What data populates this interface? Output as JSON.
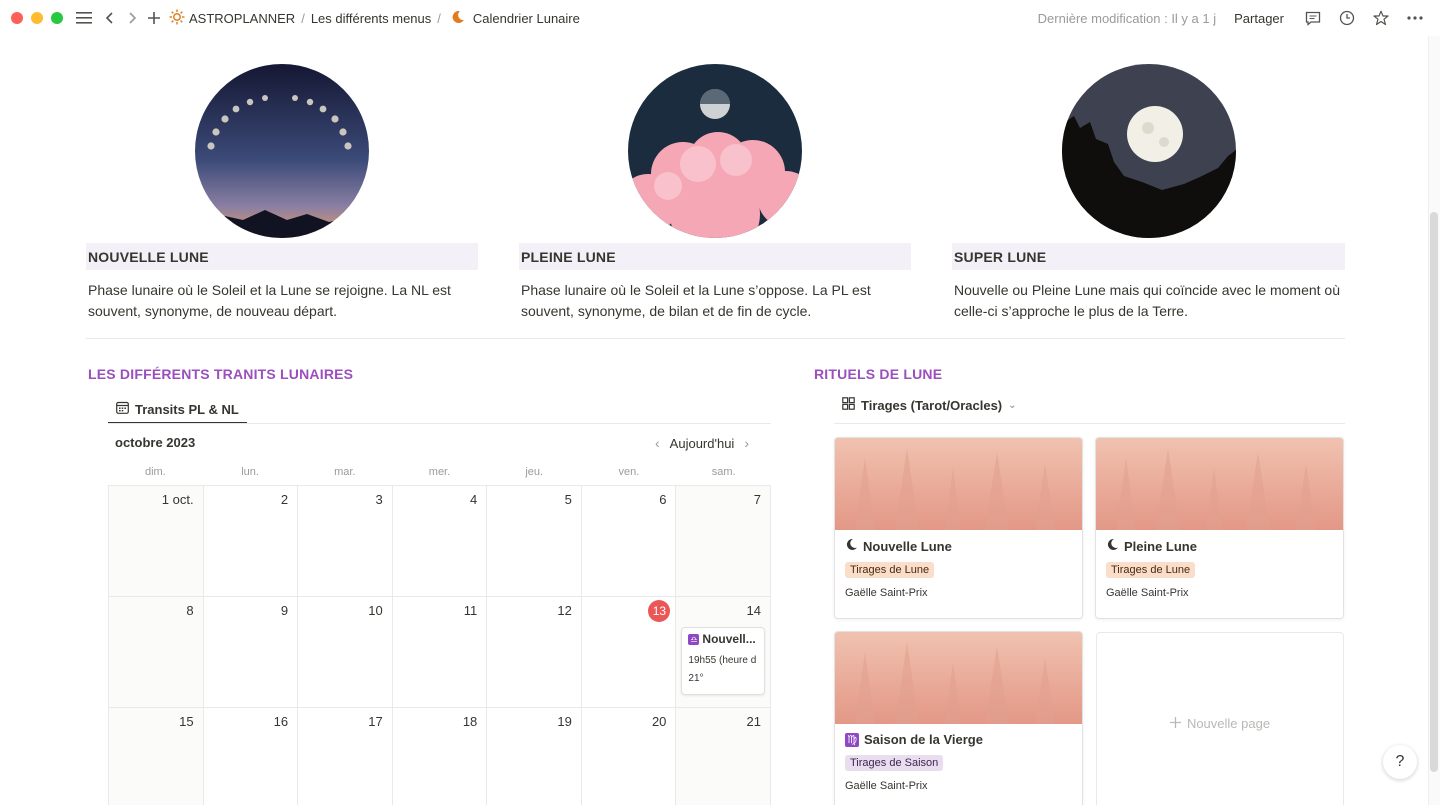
{
  "titlebar": {
    "workspace": "ASTROPLANNER",
    "crumb2": "Les différents menus",
    "crumb3": "Calendrier Lunaire",
    "modified": "Dernière modification : Il y a 1 j",
    "share": "Partager"
  },
  "moons": [
    {
      "title": "NOUVELLE LUNE",
      "desc": "Phase lunaire où le Soleil et la Lune se rejoigne. La NL est souvent, synonyme, de nouveau départ."
    },
    {
      "title": "PLEINE LUNE",
      "desc": "Phase lunaire où le Soleil et la Lune s’oppose. La PL est souvent, synonyme, de bilan et de fin de cycle."
    },
    {
      "title": "SUPER LUNE",
      "desc": "Nouvelle ou Pleine Lune mais qui coïncide avec le moment où celle-ci s’approche le plus de la Terre."
    }
  ],
  "transits": {
    "heading": "LES DIFFÉRENTS TRANITS LUNAIRES",
    "tab": "Transits PL & NL",
    "month": "octobre 2023",
    "today": "Aujourd'hui",
    "weekdays": [
      "dim.",
      "lun.",
      "mar.",
      "mer.",
      "jeu.",
      "ven.",
      "sam."
    ],
    "days": [
      "1 oct.",
      "2",
      "3",
      "4",
      "5",
      "6",
      "7",
      "8",
      "9",
      "10",
      "11",
      "12",
      "13",
      "14",
      "15",
      "16",
      "17",
      "18",
      "19",
      "20",
      "21"
    ],
    "event": {
      "title": "Nouvell...",
      "time": "19h55 (heure d",
      "degree": "21°"
    }
  },
  "rituals": {
    "heading": "RITUELS DE LUNE",
    "view": "Tirages (Tarot/Oracles)",
    "cards": [
      {
        "title": "Nouvelle Lune",
        "tag": "Tirages de Lune",
        "author": "Gaëlle Saint-Prix"
      },
      {
        "title": "Pleine Lune",
        "tag": "Tirages de Lune",
        "author": "Gaëlle Saint-Prix"
      },
      {
        "title": "Saison de la Vierge",
        "tag": "Tirages de Saison",
        "author": "Gaëlle Saint-Prix"
      }
    ],
    "new_page": "Nouvelle page"
  },
  "help": "?"
}
